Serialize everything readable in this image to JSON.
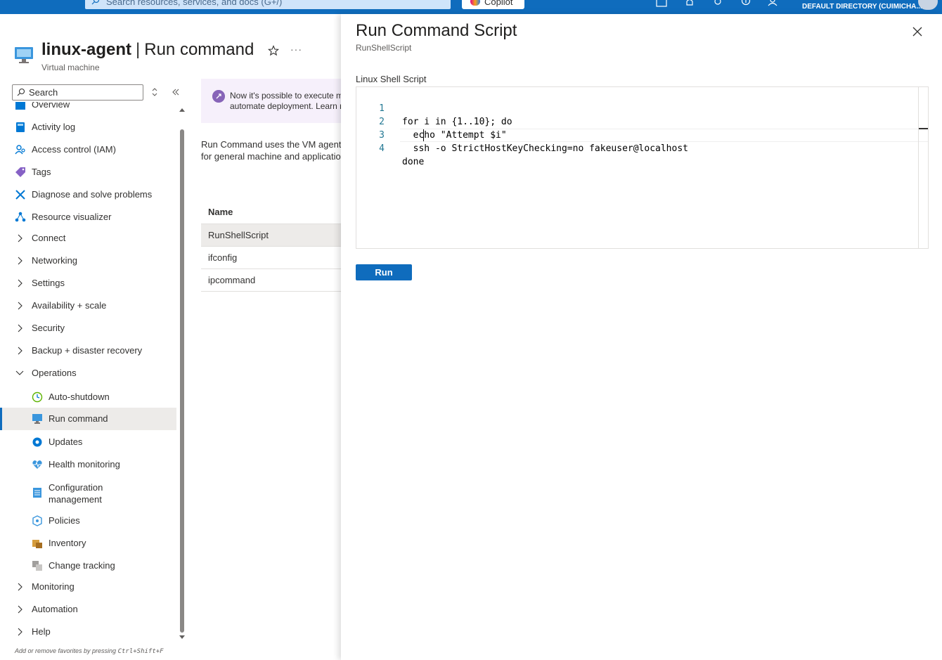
{
  "topbar": {
    "search_placeholder": "Search resources, services, and docs (G+/)",
    "copilot_label": "Copilot",
    "directory_label": "DEFAULT DIRECTORY (CUIMICHA..."
  },
  "header": {
    "resource_name": "linux-agent",
    "separator": "|",
    "page_name": "Run command",
    "subtitle": "Virtual machine",
    "more_label": "···"
  },
  "sidebar": {
    "search_placeholder": "Search",
    "items": [
      {
        "label": "Overview",
        "icon": "overview-icon"
      },
      {
        "label": "Activity log",
        "icon": "activity-log-icon"
      },
      {
        "label": "Access control (IAM)",
        "icon": "iam-icon"
      },
      {
        "label": "Tags",
        "icon": "tag-icon"
      },
      {
        "label": "Diagnose and solve problems",
        "icon": "wrench-icon"
      },
      {
        "label": "Resource visualizer",
        "icon": "visualizer-icon"
      },
      {
        "label": "Connect",
        "icon": "chevron-right-icon"
      },
      {
        "label": "Networking",
        "icon": "chevron-right-icon"
      },
      {
        "label": "Settings",
        "icon": "chevron-right-icon"
      },
      {
        "label": "Availability + scale",
        "icon": "chevron-right-icon"
      },
      {
        "label": "Security",
        "icon": "chevron-right-icon"
      },
      {
        "label": "Backup + disaster recovery",
        "icon": "chevron-right-icon"
      },
      {
        "label": "Operations",
        "icon": "chevron-down-icon"
      },
      {
        "label": "Auto-shutdown",
        "icon": "clock-icon"
      },
      {
        "label": "Run command",
        "icon": "run-command-icon"
      },
      {
        "label": "Updates",
        "icon": "gear-icon"
      },
      {
        "label": "Health monitoring",
        "icon": "heart-pulse-icon"
      },
      {
        "label": "Configuration management",
        "icon": "checklist-icon"
      },
      {
        "label": "Policies",
        "icon": "policy-icon"
      },
      {
        "label": "Inventory",
        "icon": "box-icon"
      },
      {
        "label": "Change tracking",
        "icon": "change-tracking-icon"
      },
      {
        "label": "Monitoring",
        "icon": "chevron-right-icon"
      },
      {
        "label": "Automation",
        "icon": "chevron-right-icon"
      },
      {
        "label": "Help",
        "icon": "chevron-right-icon"
      }
    ],
    "footer_hint_prefix": "Add or remove favorites by pressing ",
    "footer_hint_keys": "Ctrl+Shift+F"
  },
  "main": {
    "banner_line1": "Now it's possible to execute m",
    "banner_line2": "automate deployment. Learn r",
    "desc_line1": "Run Command uses the VM agent",
    "desc_line2": "for general machine and applicatio",
    "table_header": "Name",
    "rows": [
      "RunShellScript",
      "ifconfig",
      "ipcommand"
    ]
  },
  "panel": {
    "title": "Run Command Script",
    "subtitle": "RunShellScript",
    "field_label": "Linux Shell Script",
    "code_lines": [
      {
        "num": "1",
        "text": "for i in {1..10}; do"
      },
      {
        "num": "2",
        "text": "  echo \"Attempt $i\""
      },
      {
        "num": "3",
        "text": "  ssh -o StrictHostKeyChecking=no fakeuser@localhost"
      },
      {
        "num": "4",
        "text": "done"
      }
    ],
    "run_label": "Run"
  },
  "colors": {
    "accent": "#0f6cbd",
    "banner_bg": "#f6f0fb",
    "selected_bg": "#edebe9"
  }
}
